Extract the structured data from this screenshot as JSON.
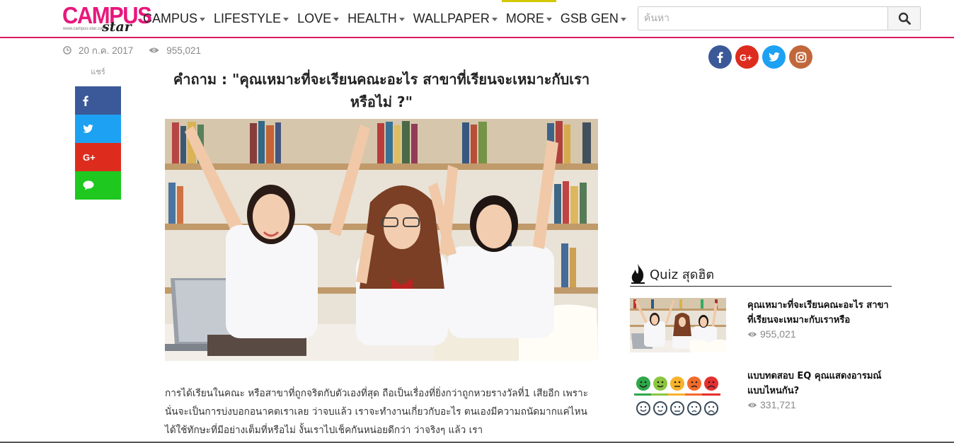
{
  "brand": {
    "logo_word": "CAMPUS",
    "logo_script": "star",
    "logo_url": "www.campus-star.com"
  },
  "nav": [
    {
      "label": "CAMPUS",
      "active": false
    },
    {
      "label": "LIFESTYLE",
      "active": false
    },
    {
      "label": "LOVE",
      "active": false
    },
    {
      "label": "HEALTH",
      "active": false
    },
    {
      "label": "WALLPAPER",
      "active": false
    },
    {
      "label": "MORE",
      "active": true
    },
    {
      "label": "GSB GEN",
      "active": false
    }
  ],
  "search": {
    "placeholder": "ค้นหา",
    "value": ""
  },
  "meta": {
    "date": "20 ก.ค. 2017",
    "views": "955,021"
  },
  "share": {
    "label": "แชร์"
  },
  "article": {
    "title": "คำถาม : \"คุณเหมาะที่จะเรียนคณะอะไร สาขาที่เรียนจะเหมาะกับเรา หรือไม่ ?\"",
    "body": "การได้เรียนในคณะ หรือสาขาที่ถูกจริตกับตัวเองที่สุด ถือเป็นเรื่องที่ยิ่งกว่าถูกหวยรางวัลที่1 เสียอีก เพราะนั่นจะเป็นการบ่งบอกอนาคตเราเลย ว่าจบแล้ว เราจะทำงานเกี่ยวกับอะไร ตนเองมีความถนัดมากแค่ไหน ได้ใช้ทักษะที่มีอย่างเต็มที่หรือไม่ งั้นเราไปเช็คกันหน่อยดีกว่า ว่าจริงๆ แล้ว เรา"
  },
  "quiz": {
    "heading": "Quiz สุดฮิต",
    "items": [
      {
        "title": "คุณเหมาะที่จะเรียนคณะอะไร สาขาที่เรียนจะเหมาะกับเราหรือ",
        "views": "955,021"
      },
      {
        "title": "แบบทดสอบ EQ คุณแสดงอารมณ์แบบไหนกัน?",
        "views": "331,721"
      }
    ]
  },
  "colors": {
    "brand_pink": "#e8177c",
    "nav_border": "#d81b60",
    "facebook": "#3b5998",
    "twitter": "#1da1f2",
    "googleplus": "#dd2c1e",
    "line": "#1ec81e",
    "instagram": "#c1673a"
  }
}
